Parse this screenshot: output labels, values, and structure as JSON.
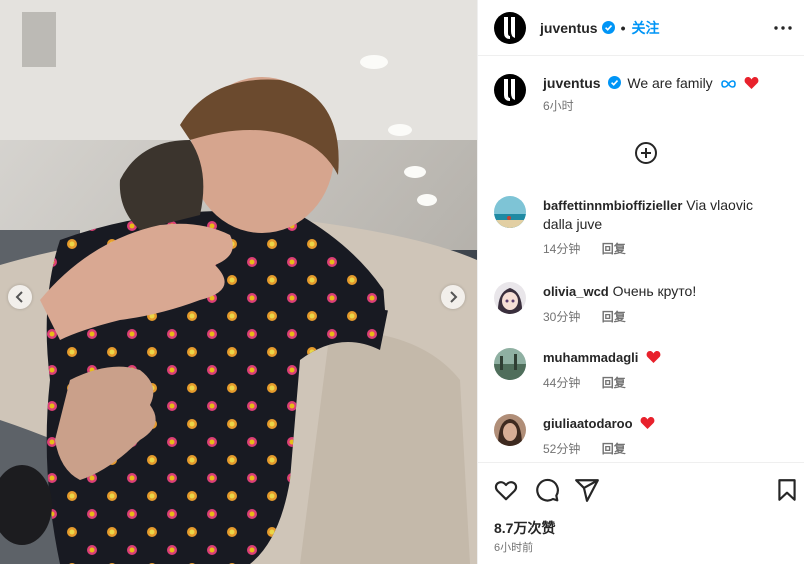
{
  "post": {
    "username": "juventus",
    "follow_label": "关注",
    "dot": "•",
    "caption_text": "We are family",
    "caption_time": "6小时",
    "likes": "8.7万次赞",
    "posted_time": "6小时前"
  },
  "comments": [
    {
      "user": "baffettinnmbioffizieller",
      "text": "Via vlaovic dalla juve",
      "time": "14分钟",
      "reply": "回复"
    },
    {
      "user": "olivia_wcd",
      "text": "Очень круто!",
      "time": "30分钟",
      "reply": "回复"
    },
    {
      "user": "muhammadagli",
      "text": "",
      "time": "44分钟",
      "reply": "回复"
    },
    {
      "user": "giuliaatodaroo",
      "text": "",
      "time": "52分钟",
      "reply": "回复"
    }
  ],
  "colors": {
    "accent": "#0095f6",
    "verified": "#0095f6",
    "heart": "#ff3040",
    "infinity": "#0095f6"
  },
  "icons": [
    "juventus-logo-icon",
    "verified-icon",
    "more-options-icon",
    "load-more-comments-icon",
    "heart-emoji-icon",
    "infinity-emoji-icon",
    "like-icon",
    "comment-icon",
    "share-icon",
    "save-icon",
    "chevron-left-icon",
    "chevron-right-icon"
  ]
}
